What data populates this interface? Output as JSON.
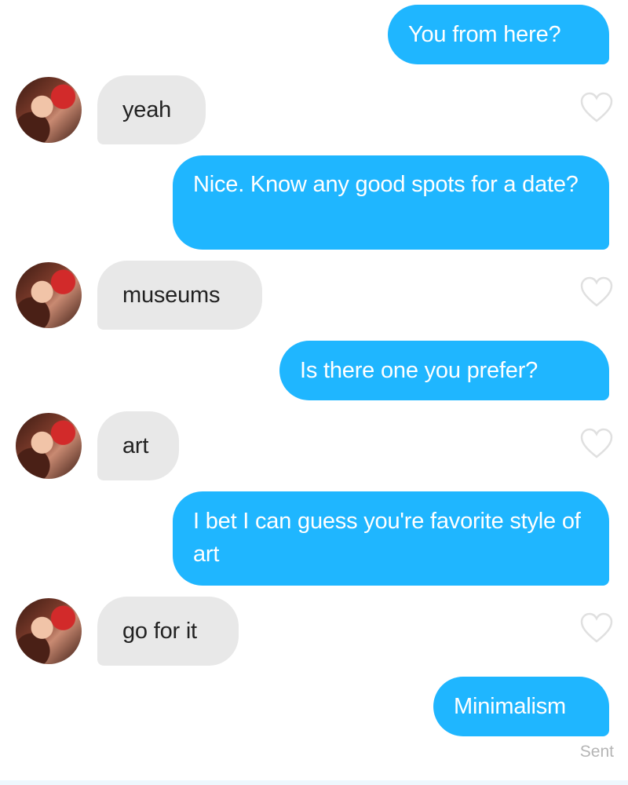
{
  "messages": [
    {
      "from": "me",
      "text": "You from here?"
    },
    {
      "from": "them",
      "text": "yeah"
    },
    {
      "from": "me",
      "text": "Nice. Know any good spots for a date?"
    },
    {
      "from": "them",
      "text": "museums"
    },
    {
      "from": "me",
      "text": "Is there one you prefer?"
    },
    {
      "from": "them",
      "text": "art"
    },
    {
      "from": "me",
      "text": "I bet I can guess you're favorite style of art"
    },
    {
      "from": "them",
      "text": "go for it"
    },
    {
      "from": "me",
      "text": "Minimalism"
    }
  ],
  "status": {
    "last_message": "Sent"
  },
  "icons": {
    "like": "heart-outline-icon",
    "avatar": "profile-photo"
  },
  "colors": {
    "outgoing_bubble": "#1fb6ff",
    "incoming_bubble": "#e8e8e8",
    "heart_stroke": "#e0e0e0",
    "sent_text": "#b5b5b5"
  }
}
